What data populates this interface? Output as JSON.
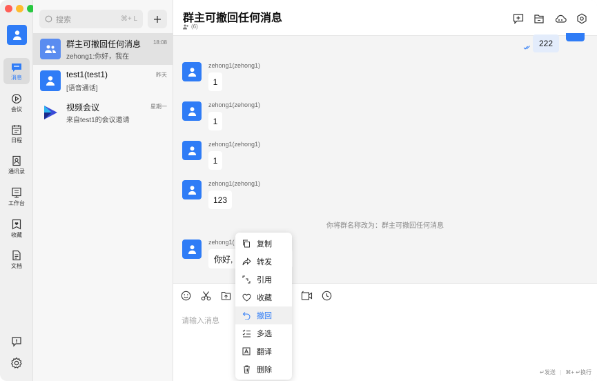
{
  "rail": {
    "items": [
      {
        "label": "消息"
      },
      {
        "label": "会议"
      },
      {
        "label": "日程"
      },
      {
        "label": "通讯录"
      },
      {
        "label": "工作台"
      },
      {
        "label": "收藏"
      },
      {
        "label": "文档"
      }
    ]
  },
  "search": {
    "placeholder": "搜索",
    "shortcut": "⌘+ L"
  },
  "conversations": [
    {
      "name": "群主可撤回任何消息",
      "preview": "zehong1:你好，我在",
      "time": "18:08"
    },
    {
      "name": "test1(test1)",
      "preview": "[语音通话]",
      "time": "昨天"
    },
    {
      "name": "视频会议",
      "preview": "来自test1的会议邀请",
      "time": "星期一"
    }
  ],
  "chat": {
    "title": "群主可撤回任何消息",
    "member_count": "(6)",
    "my_message": "222",
    "messages": [
      {
        "sender": "zehong1(zehong1)",
        "text": "1"
      },
      {
        "sender": "zehong1(zehong1)",
        "text": "1"
      },
      {
        "sender": "zehong1(zehong1)",
        "text": "1"
      },
      {
        "sender": "zehong1(zehong1)",
        "text": "123"
      },
      {
        "sender": "zehong1(",
        "text": "你好,"
      }
    ],
    "system_message": "你将群名称改为：群主可撤回任何消息",
    "input_placeholder": "请输入消息",
    "send_hint": "↵发送",
    "newline_hint": "⌘+ ↵换行"
  },
  "context_menu": {
    "items": [
      {
        "label": "复制"
      },
      {
        "label": "转发"
      },
      {
        "label": "引用"
      },
      {
        "label": "收藏"
      },
      {
        "label": "撤回"
      },
      {
        "label": "多选"
      },
      {
        "label": "翻译"
      },
      {
        "label": "删除"
      }
    ]
  },
  "colors": {
    "accent": "#2f7cf6"
  }
}
